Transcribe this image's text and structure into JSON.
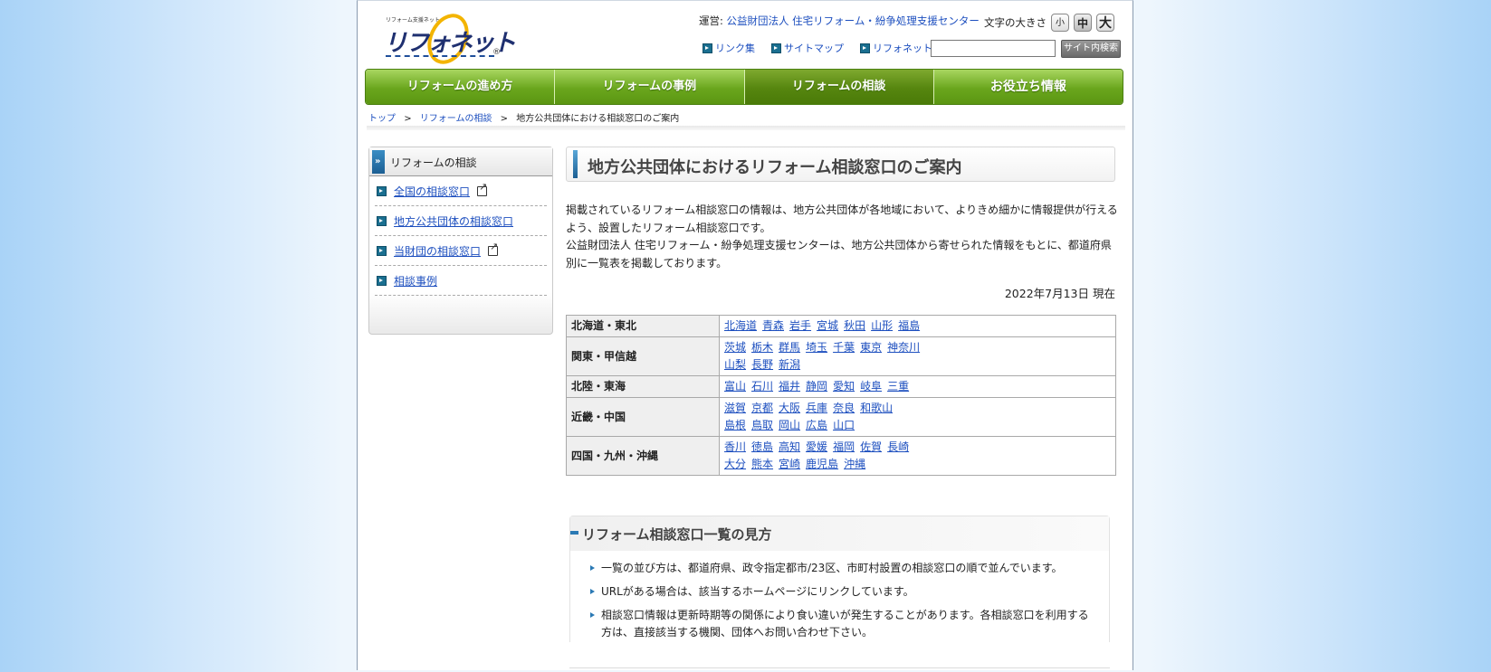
{
  "header": {
    "logo_small_text": "リフォーム支援ネット",
    "logo_text": "リフォネット",
    "logo_mark": "®",
    "operator_label": "運営:",
    "operator_name": "公益財団法人 住宅リフォーム・紛争処理支援センター",
    "fontsize_label": "文字の大きさ",
    "fontsize_small": "小",
    "fontsize_medium": "中",
    "fontsize_large": "大",
    "links": [
      "リンク集",
      "サイトマップ",
      "リフォネットTOP"
    ],
    "search_placeholder": "",
    "search_button": "サイト内検索"
  },
  "nav": {
    "items": [
      "リフォームの進め方",
      "リフォームの事例",
      "リフォームの相談",
      "お役立ち情報"
    ],
    "active_index": 2
  },
  "breadcrumb": {
    "items": [
      "トップ",
      "リフォームの相談"
    ],
    "current": "地方公共団体における相談窓口のご案内",
    "separator": ">"
  },
  "sidebar": {
    "title": "リフォームの相談",
    "items": [
      {
        "label": "全国の相談窓口",
        "external": true
      },
      {
        "label": "地方公共団体の相談窓口",
        "external": false
      },
      {
        "label": "当財団の相談窓口",
        "external": true
      },
      {
        "label": "相談事例",
        "external": false
      }
    ]
  },
  "main": {
    "title": "地方公共団体におけるリフォーム相談窓口のご案内",
    "intro_1": "掲載されているリフォーム相談窓口の情報は、地方公共団体が各地域において、よりきめ細かに情報提供が行えるよう、設置したリフォーム相談窓口です。",
    "intro_2": "公益財団法人 住宅リフォーム・紛争処理支援センターは、地方公共団体から寄せられた情報をもとに、都道府県別に一覧表を掲載しております。",
    "date": "2022年7月13日 現在",
    "regions": [
      {
        "name": "北海道・東北",
        "lines": [
          [
            "北海道",
            "青森",
            "岩手",
            "宮城",
            "秋田",
            "山形",
            "福島"
          ]
        ]
      },
      {
        "name": "関東・甲信越",
        "lines": [
          [
            "茨城",
            "栃木",
            "群馬",
            "埼玉",
            "千葉",
            "東京",
            "神奈川"
          ],
          [
            "山梨",
            "長野",
            "新潟"
          ]
        ]
      },
      {
        "name": "北陸・東海",
        "lines": [
          [
            "富山",
            "石川",
            "福井",
            "静岡",
            "愛知",
            "岐阜",
            "三重"
          ]
        ]
      },
      {
        "name": "近畿・中国",
        "lines": [
          [
            "滋賀",
            "京都",
            "大阪",
            "兵庫",
            "奈良",
            "和歌山"
          ],
          [
            "島根",
            "鳥取",
            "岡山",
            "広島",
            "山口"
          ]
        ]
      },
      {
        "name": "四国・九州・沖縄",
        "lines": [
          [
            "香川",
            "徳島",
            "高知",
            "愛媛",
            "福岡",
            "佐賀",
            "長崎"
          ],
          [
            "大分",
            "熊本",
            "宮崎",
            "鹿児島",
            "沖縄"
          ]
        ]
      }
    ],
    "howto": {
      "title": "リフォーム相談窓口一覧の見方",
      "items": [
        "一覧の並び方は、都道府県、政令指定都市/23区、市町村設置の相談窓口の順で並んでいます。",
        "URLがある場合は、該当するホームページにリンクしています。",
        "相談窓口情報は更新時期等の関係により食い違いが発生することがあります。各相談窓口を利用する方は、直接該当する機関、団体へお問い合わせ下さい。"
      ]
    }
  },
  "colors": {
    "link": "#1d4fbf",
    "nav_green": "#6aa61d",
    "nav_active": "#56860f",
    "accent_blue": "#2a79b4"
  }
}
